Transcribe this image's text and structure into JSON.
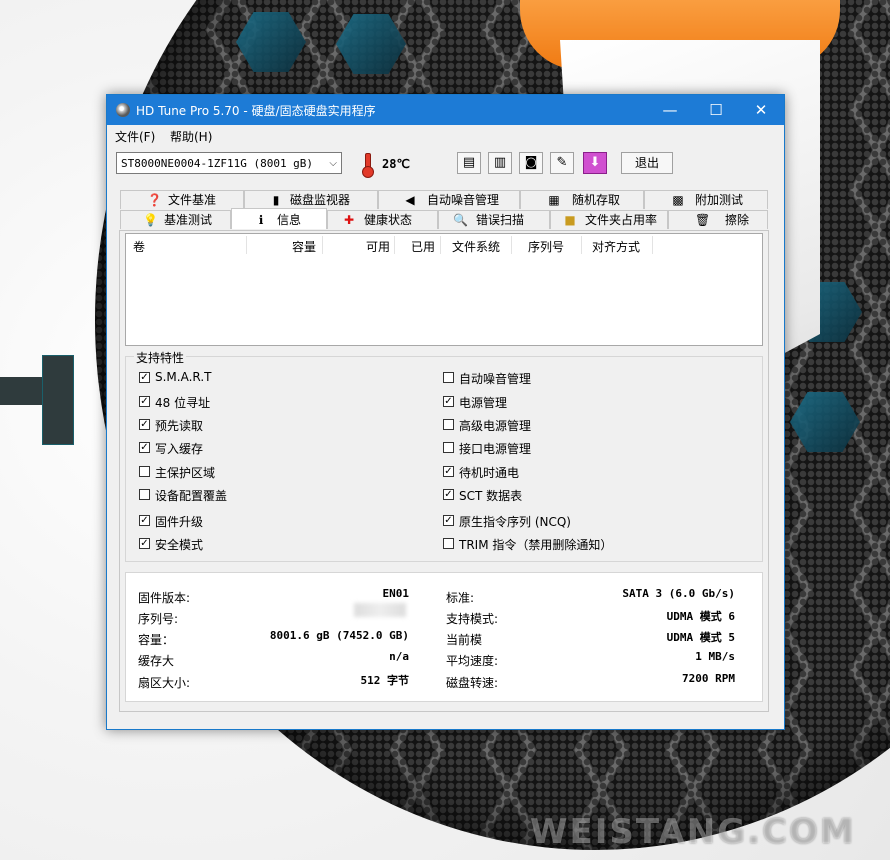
{
  "window": {
    "title": "HD Tune Pro 5.70 - 硬盘/固态硬盘实用程序",
    "min": "—",
    "max": "☐",
    "close": "✕"
  },
  "menu": [
    "文件(F)",
    "帮助(H)"
  ],
  "toolbar": {
    "drive": "ST8000NE0004-1ZF11G (8001 gB)",
    "temperature": "28℃",
    "exit": "退出"
  },
  "tabs_row1": [
    {
      "label": "文件基准",
      "icon": "file-benchmark-icon"
    },
    {
      "label": "磁盘监视器",
      "icon": "disk-monitor-icon"
    },
    {
      "label": "自动噪音管理",
      "icon": "speaker-icon"
    },
    {
      "label": "随机存取",
      "icon": "random-access-icon"
    },
    {
      "label": "附加测试",
      "icon": "extra-tests-icon"
    }
  ],
  "tabs_row2": [
    {
      "label": "基准测试",
      "icon": "lightbulb-icon"
    },
    {
      "label": "信息",
      "icon": "info-icon"
    },
    {
      "label": "健康状态",
      "icon": "health-cross-icon"
    },
    {
      "label": "错误扫描",
      "icon": "magnifier-icon"
    },
    {
      "label": "文件夹占用率",
      "icon": "folder-icon"
    },
    {
      "label": "擦除",
      "icon": "trash-icon"
    }
  ],
  "volume_columns": [
    "卷",
    "容量",
    "可用",
    "已用",
    "文件系统",
    "序列号",
    "对齐方式"
  ],
  "features_title": "支持特性",
  "features_left": [
    {
      "label": "S.M.A.R.T",
      "checked": true
    },
    {
      "label": "48 位寻址",
      "checked": true
    },
    {
      "label": "预先读取",
      "checked": true
    },
    {
      "label": "写入缓存",
      "checked": true
    },
    {
      "label": "主保护区域",
      "checked": false
    },
    {
      "label": "设备配置覆盖",
      "checked": false
    },
    {
      "label": "固件升级",
      "checked": true
    },
    {
      "label": "安全模式",
      "checked": true
    }
  ],
  "features_right": [
    {
      "label": "自动噪音管理",
      "checked": false
    },
    {
      "label": "电源管理",
      "checked": true
    },
    {
      "label": "高级电源管理",
      "checked": false
    },
    {
      "label": "接口电源管理",
      "checked": false
    },
    {
      "label": "待机时通电",
      "checked": true
    },
    {
      "label": "SCT 数据表",
      "checked": true
    },
    {
      "label": "原生指令序列 (NCQ)",
      "checked": true
    },
    {
      "label": "TRIM 指令（禁用删除通知）",
      "checked": false
    }
  ],
  "info_left": [
    {
      "key": "固件版本:",
      "value": "EN01"
    },
    {
      "key": "序列号:",
      "value": ""
    },
    {
      "key": "容量：",
      "value": "8001.6 gB (7452.0 GB)"
    },
    {
      "key": "缓存大",
      "value": "n/a"
    },
    {
      "key": "扇区大小:",
      "value": "512 字节"
    }
  ],
  "info_right": [
    {
      "key": "标准:",
      "value": "SATA 3 (6.0 Gb/s)"
    },
    {
      "key": "支持模式:",
      "value": "UDMA 模式 6"
    },
    {
      "key": "当前模",
      "value": "UDMA 模式 5"
    },
    {
      "key": "平均速度:",
      "value": "1 MB/s"
    },
    {
      "key": "磁盘转速:",
      "value": "7200 RPM"
    }
  ],
  "watermark": "WEISTANG.COM"
}
